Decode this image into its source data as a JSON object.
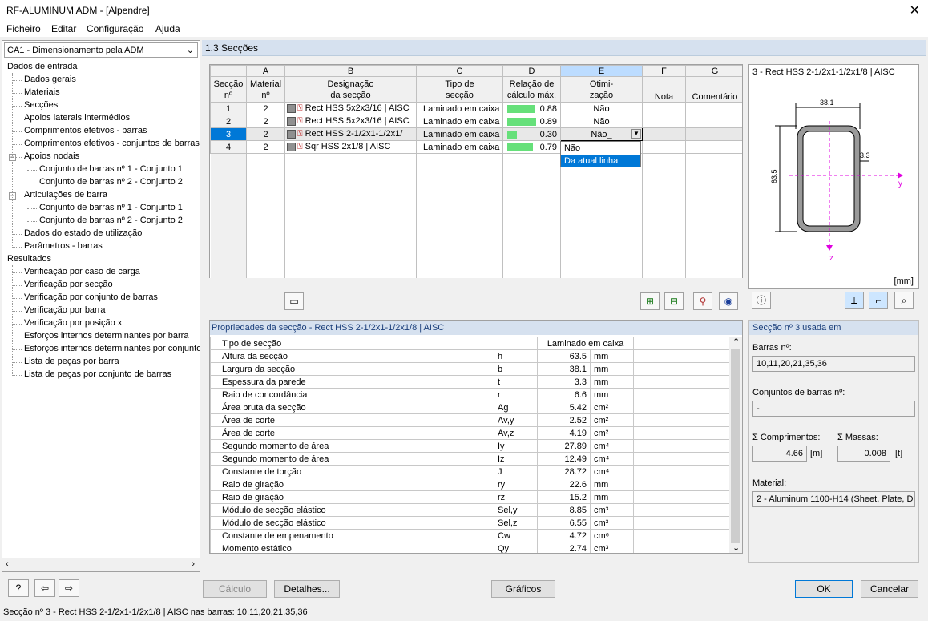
{
  "window": {
    "title": "RF-ALUMINUM ADM - [Alpendre]"
  },
  "menu": [
    "Ficheiro",
    "Editar",
    "Configuração",
    "Ajuda"
  ],
  "case_select": "CA1 - Dimensionamento pela ADM",
  "tree": [
    {
      "label": "Dados de entrada",
      "level": 0
    },
    {
      "label": "Dados gerais",
      "level": 1
    },
    {
      "label": "Materiais",
      "level": 1
    },
    {
      "label": "Secções",
      "level": 1
    },
    {
      "label": "Apoios laterais intermédios",
      "level": 1
    },
    {
      "label": "Comprimentos efetivos - barras",
      "level": 1
    },
    {
      "label": "Comprimentos efetivos - conjuntos de barras",
      "level": 1
    },
    {
      "label": "Apoios nodais",
      "level": 1,
      "expander": "−"
    },
    {
      "label": "Conjunto de barras nº 1 - Conjunto 1",
      "level": 2
    },
    {
      "label": "Conjunto de barras nº 2 - Conjunto 2",
      "level": 2
    },
    {
      "label": "Articulações de barra",
      "level": 1,
      "expander": "−"
    },
    {
      "label": "Conjunto de barras nº 1 - Conjunto 1",
      "level": 2
    },
    {
      "label": "Conjunto de barras nº 2 - Conjunto 2",
      "level": 2
    },
    {
      "label": "Dados do estado de utilização",
      "level": 1
    },
    {
      "label": "Parâmetros - barras",
      "level": 1
    },
    {
      "label": "Resultados",
      "level": 0
    },
    {
      "label": "Verificação por caso de carga",
      "level": 1
    },
    {
      "label": "Verificação por secção",
      "level": 1
    },
    {
      "label": "Verificação por conjunto de barras",
      "level": 1
    },
    {
      "label": "Verificação por barra",
      "level": 1
    },
    {
      "label": "Verificação por posição x",
      "level": 1
    },
    {
      "label": "Esforços internos determinantes por barra",
      "level": 1
    },
    {
      "label": "Esforços internos determinantes por conjunto",
      "level": 1
    },
    {
      "label": "Lista de peças por barra",
      "level": 1
    },
    {
      "label": "Lista de peças por conjunto de barras",
      "level": 1
    }
  ],
  "section_title": "1.3 Secções",
  "grid": {
    "col_letters": [
      "A",
      "B",
      "C",
      "D",
      "E",
      "F",
      "G"
    ],
    "headers": {
      "sec1": "Secção",
      "sec2": "nº",
      "mat1": "Material",
      "mat2": "nº",
      "des1": "Designação",
      "des2": "da secção",
      "tip1": "Tipo de",
      "tip2": "secção",
      "rel1": "Relação de",
      "rel2": "cálculo máx.",
      "oti1": "Otimi-",
      "oti2": "zação",
      "nota": "Nota",
      "com": "Comentário"
    },
    "rows": [
      {
        "no": "1",
        "mat": "2",
        "des": "Rect HSS 5x2x3/16 | AISC",
        "tipo": "Laminado em caixa",
        "ratio": "0.88",
        "ratio_frac": 0.88,
        "oti": "Não"
      },
      {
        "no": "2",
        "mat": "2",
        "des": "Rect HSS 5x2x3/16 | AISC",
        "tipo": "Laminado em caixa",
        "ratio": "0.89",
        "ratio_frac": 0.89,
        "oti": "Não"
      },
      {
        "no": "3",
        "mat": "2",
        "des": "Rect HSS 2-1/2x1-1/2x1/",
        "tipo": "Laminado em caixa",
        "ratio": "0.30",
        "ratio_frac": 0.3,
        "oti": "Não"
      },
      {
        "no": "4",
        "mat": "2",
        "des": "Sqr HSS 2x1/8 | AISC",
        "tipo": "Laminado em caixa",
        "ratio": "0.79",
        "ratio_frac": 0.79,
        "oti": ""
      }
    ],
    "dropdown_options": [
      "Não",
      "Da atual linha"
    ]
  },
  "preview": {
    "title": "3 - Rect HSS 2-1/2x1-1/2x1/8 | AISC",
    "dim_b": "38.1",
    "dim_h": "63.5",
    "dim_t": "3.3",
    "axis_y": "y",
    "axis_z": "z",
    "unit": "[mm]"
  },
  "props": {
    "header": "Propriedades da secção  -  Rect HSS 2-1/2x1-1/2x1/8 | AISC",
    "rows": [
      {
        "name": "Tipo de secção",
        "sym": "",
        "val": "Laminado em caixa",
        "unit": ""
      },
      {
        "name": "Altura da secção",
        "sym": "h",
        "val": "63.5",
        "unit": "mm"
      },
      {
        "name": "Largura da secção",
        "sym": "b",
        "val": "38.1",
        "unit": "mm"
      },
      {
        "name": "Espessura da parede",
        "sym": "t",
        "val": "3.3",
        "unit": "mm"
      },
      {
        "name": "Raio de concordância",
        "sym": "r",
        "val": "6.6",
        "unit": "mm"
      },
      {
        "name": "Área bruta da secção",
        "sym": "Ag",
        "val": "5.42",
        "unit": "cm²"
      },
      {
        "name": "Área de corte",
        "sym": "Av,y",
        "val": "2.52",
        "unit": "cm²"
      },
      {
        "name": "Área de corte",
        "sym": "Av,z",
        "val": "4.19",
        "unit": "cm²"
      },
      {
        "name": "Segundo momento de área",
        "sym": "Iy",
        "val": "27.89",
        "unit": "cm⁴"
      },
      {
        "name": "Segundo momento de área",
        "sym": "Iz",
        "val": "12.49",
        "unit": "cm⁴"
      },
      {
        "name": "Constante de torção",
        "sym": "J",
        "val": "28.72",
        "unit": "cm⁴"
      },
      {
        "name": "Raio de giração",
        "sym": "ry",
        "val": "22.6",
        "unit": "mm"
      },
      {
        "name": "Raio de giração",
        "sym": "rz",
        "val": "15.2",
        "unit": "mm"
      },
      {
        "name": "Módulo de secção elástico",
        "sym": "Sel,y",
        "val": "8.85",
        "unit": "cm³"
      },
      {
        "name": "Módulo de secção elástico",
        "sym": "Sel,z",
        "val": "6.55",
        "unit": "cm³"
      },
      {
        "name": "Constante de empenamento",
        "sym": "Cw",
        "val": "4.72",
        "unit": "cm⁶"
      },
      {
        "name": "Momento estático",
        "sym": "Qy",
        "val": "2.74",
        "unit": "cm³"
      }
    ]
  },
  "used": {
    "header": "Secção nº 3 usada em",
    "barras_label": "Barras nº:",
    "barras": "10,11,20,21,35,36",
    "conj_label": "Conjuntos de barras nº:",
    "conj": "-",
    "comp_label": "Σ Comprimentos:",
    "comp": "4.66",
    "comp_unit": "[m]",
    "mass_label": "Σ Massas:",
    "mass": "0.008",
    "mass_unit": "[t]",
    "mat_label": "Material:",
    "mat": "2 - Aluminum 1100-H14 (Sheet, Plate, Dr"
  },
  "buttons": {
    "calc": "Cálculo",
    "details": "Detalhes...",
    "graphics": "Gráficos",
    "ok": "OK",
    "cancel": "Cancelar"
  },
  "status": "Secção nº 3 - Rect HSS 2-1/2x1-1/2x1/8 | AISC nas barras: 10,11,20,21,35,36"
}
